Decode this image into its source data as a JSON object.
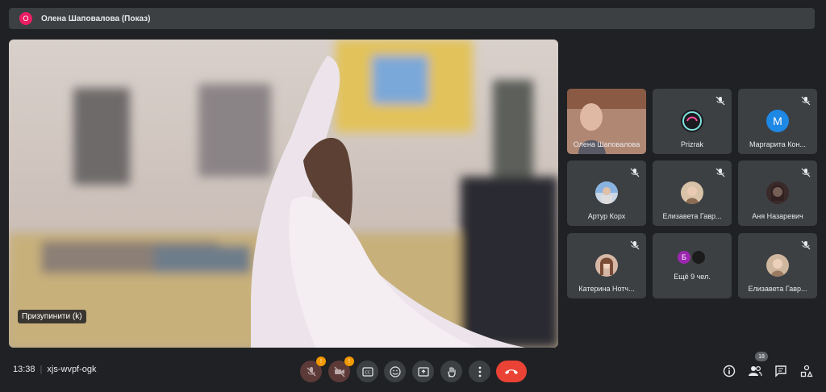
{
  "presentation": {
    "avatar_letter": "О",
    "label": "Олена Шаповалова (Показ)"
  },
  "stage": {
    "caption": "Призупинити (k)"
  },
  "participants": [
    {
      "name": "Олена Шаповалова",
      "muted": false,
      "kind": "video"
    },
    {
      "name": "Prizrak",
      "muted": true,
      "kind": "photo"
    },
    {
      "name": "Маргарита Кон...",
      "muted": true,
      "kind": "letter",
      "letter": "M",
      "color": "#1e88e5"
    },
    {
      "name": "Артур Корх",
      "muted": true,
      "kind": "photo"
    },
    {
      "name": "Елизавета Гавр...",
      "muted": true,
      "kind": "photo"
    },
    {
      "name": "Аня Назаревич",
      "muted": true,
      "kind": "photo"
    },
    {
      "name": "Катерина Нотч...",
      "muted": true,
      "kind": "photo"
    },
    {
      "name": "Ещё 9 чел.",
      "muted": false,
      "kind": "group",
      "letter": "Б"
    },
    {
      "name": "Елизавета Гавр...",
      "muted": true,
      "kind": "photo"
    }
  ],
  "meeting": {
    "time": "13:38",
    "code": "xjs-wvpf-ogk"
  },
  "controls": {
    "mic_badge": "!",
    "cam_badge": "!",
    "people_count": "18"
  },
  "colors": {
    "end_call": "#ea4335",
    "warning": "#f29900"
  }
}
